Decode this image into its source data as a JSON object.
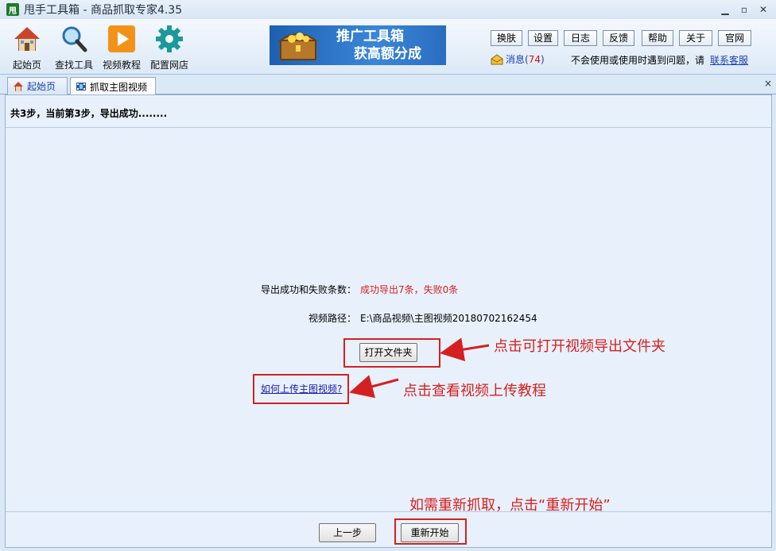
{
  "window": {
    "title": "甩手工具箱 - 商品抓取专家4.35",
    "app_icon_glyph": "甩",
    "minimize_glyph": "▁",
    "maximize_glyph": "▫",
    "close_glyph": "✕"
  },
  "toolbar": {
    "buttons": [
      {
        "label": "起始页",
        "icon": "home-icon"
      },
      {
        "label": "查找工具",
        "icon": "magnifier-icon"
      },
      {
        "label": "视频教程",
        "icon": "play-icon"
      },
      {
        "label": "配置网店",
        "icon": "gear-icon"
      }
    ],
    "promo": {
      "line1": "推广工具箱",
      "line2": "获高额分成"
    },
    "small_buttons": [
      "换肤",
      "设置",
      "日志",
      "反馈",
      "帮助",
      "关于",
      "官网"
    ],
    "message": {
      "label": "消息(",
      "count": "74",
      "suffix": ")"
    },
    "help_text": "不会使用或使用时遇到问题，请",
    "contact_link": "联系客服"
  },
  "tabs": [
    {
      "label": "起始页",
      "icon": "home-icon",
      "active": false
    },
    {
      "label": "抓取主图视频",
      "icon": "film-icon",
      "active": true
    }
  ],
  "tab_close_glyph": "×",
  "main": {
    "steps_text": "共3步，当前第3步，导出成功........",
    "result_label": "导出成功和失败条数：",
    "result_value": "成功导出7条，失败0条",
    "path_label": "视频路径：",
    "path_value": "E:\\商品视频\\主图视频20180702162454",
    "open_folder_button": "打开文件夹",
    "upload_link": "如何上传主图视频?",
    "prev_button": "上一步",
    "restart_button": "重新开始"
  },
  "annotations": {
    "open_folder": "点击可打开视频导出文件夹",
    "upload_tutorial": "点击查看视频上传教程",
    "restart": "如需重新抓取，点击“重新开始”"
  },
  "colors": {
    "annotation_red": "#d42020",
    "link_blue": "#1a1ab0",
    "content_bg": "#e8f1fb"
  }
}
